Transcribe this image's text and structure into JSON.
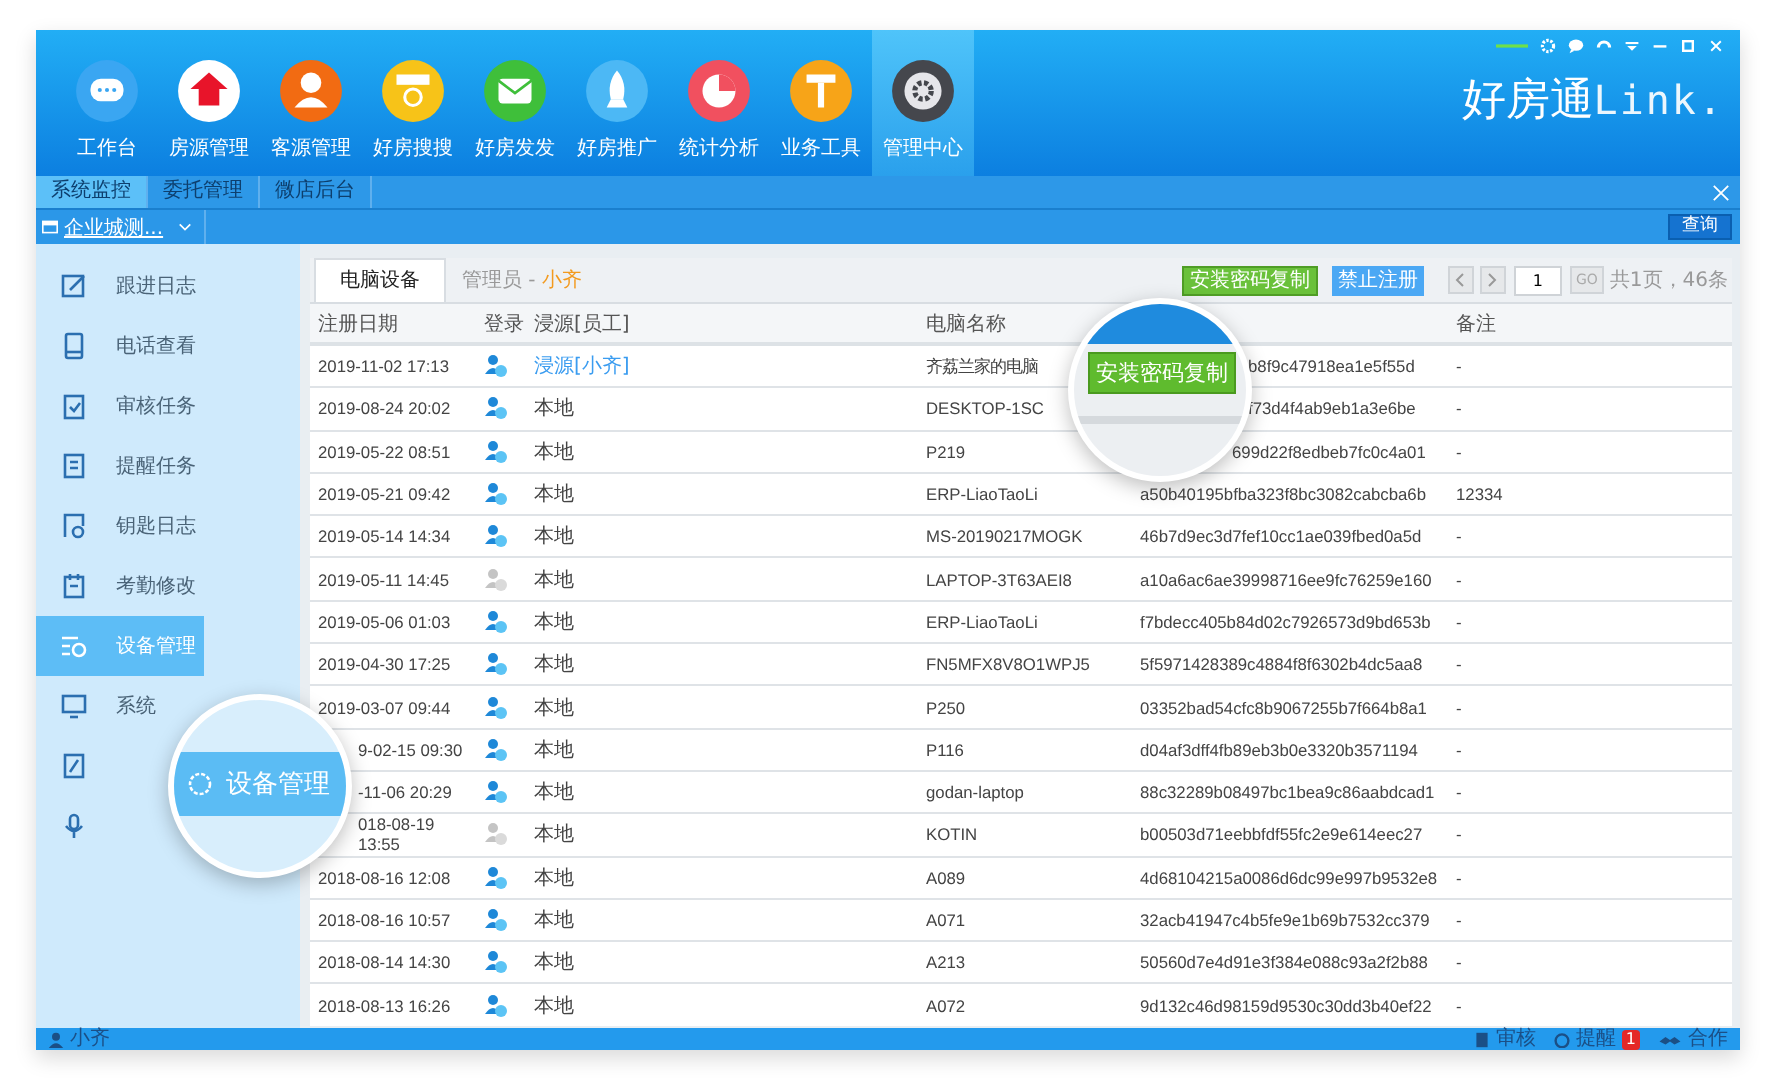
{
  "nav": [
    {
      "label": "工作台",
      "kind": "chat",
      "color": "#3aa6f2",
      "selected": false
    },
    {
      "label": "房源管理",
      "kind": "house",
      "color": "#ffffff",
      "selected": false
    },
    {
      "label": "客源管理",
      "kind": "person",
      "color": "#f26b12",
      "selected": false
    },
    {
      "label": "好房搜搜",
      "kind": "search",
      "color": "#f7c318",
      "selected": false
    },
    {
      "label": "好房发发",
      "kind": "mail",
      "color": "#3fbf3a",
      "selected": false
    },
    {
      "label": "好房推广",
      "kind": "rocket",
      "color": "#4cb8f5",
      "selected": false
    },
    {
      "label": "统计分析",
      "kind": "pie",
      "color": "#f1505f",
      "selected": false
    },
    {
      "label": "业务工具",
      "kind": "hammer",
      "color": "#f7a418",
      "selected": false
    },
    {
      "label": "管理中心",
      "kind": "gear",
      "color": "#45474d",
      "selected": true
    }
  ],
  "logo": {
    "brand": "好房通",
    "suffix": "Link."
  },
  "subtabs": [
    {
      "label": "系统监控",
      "selected": true
    },
    {
      "label": "委托管理",
      "selected": false
    },
    {
      "label": "微店后台",
      "selected": false
    }
  ],
  "filter": {
    "company": "企业城测...",
    "query_button": "查询"
  },
  "sidebar": [
    {
      "label": "跟进日志",
      "kind": "edit",
      "selected": false
    },
    {
      "label": "电话查看",
      "kind": "phone",
      "selected": false
    },
    {
      "label": "审核任务",
      "kind": "clipboard",
      "selected": false
    },
    {
      "label": "提醒任务",
      "kind": "doc",
      "selected": false
    },
    {
      "label": "钥匙日志",
      "kind": "key",
      "selected": false
    },
    {
      "label": "考勤修改",
      "kind": "calendar",
      "selected": false
    },
    {
      "label": "设备管理",
      "kind": "settings",
      "selected": true
    },
    {
      "label": "系统",
      "kind": "monitor",
      "selected": false
    },
    {
      "kind": "docedit",
      "selected": false
    },
    {
      "kind": "mic",
      "selected": false
    }
  ],
  "content_tab": {
    "label": "电脑设备",
    "admin_label": "管理员 -",
    "admin_name": "小齐"
  },
  "actions": {
    "copy_button": "安装密码复制",
    "block_button": "禁止注册",
    "page_input": "1",
    "go_button": "GO",
    "page_info": "共1页，46条"
  },
  "table": {
    "columns": [
      "注册日期",
      "登录",
      "浸源[员工]",
      "电脑名称",
      "备注"
    ],
    "rows": [
      {
        "date": "2019-11-02 17:13",
        "online": true,
        "source": "浸源[小齐]",
        "source_link": true,
        "name": "齐荔兰家的电脑",
        "code": "b8f9c47918ea1e5f55d",
        "note": "-"
      },
      {
        "date": "2019-08-24 20:02",
        "online": true,
        "source": "本地",
        "source_link": false,
        "name": "DESKTOP-1SC",
        "code": "f73d4f4ab9eb1a3e6be",
        "note": "-"
      },
      {
        "date": "2019-05-22 08:51",
        "online": true,
        "source": "本地",
        "source_link": false,
        "name": "P219",
        "code": "699d22f8edbeb7fc0c4a01",
        "note": "-"
      },
      {
        "date": "2019-05-21 09:42",
        "online": true,
        "source": "本地",
        "source_link": false,
        "name": "ERP-LiaoTaoLi",
        "code": "a50b40195bfba323f8bc3082cabcba6b",
        "note": "12334"
      },
      {
        "date": "2019-05-14 14:34",
        "online": true,
        "source": "本地",
        "source_link": false,
        "name": "MS-20190217MOGK",
        "code": "46b7d9ec3d7fef10cc1ae039fbed0a5d",
        "note": "-"
      },
      {
        "date": "2019-05-11 14:45",
        "online": false,
        "source": "本地",
        "source_link": false,
        "name": "LAPTOP-3T63AEI8",
        "code": "a10a6ac6ae39998716ee9fc76259e160",
        "note": "-"
      },
      {
        "date": "2019-05-06 01:03",
        "online": true,
        "source": "本地",
        "source_link": false,
        "name": "ERP-LiaoTaoLi",
        "code": "f7bdecc405b84d02c7926573d9bd653b",
        "note": "-"
      },
      {
        "date": "2019-04-30 17:25",
        "online": true,
        "source": "本地",
        "source_link": false,
        "name": "FN5MFX8V8O1WPJ5",
        "code": "5f5971428389c4884f8f6302b4dc5aa8",
        "note": "-"
      },
      {
        "date": "2019-03-07 09:44",
        "online": true,
        "source": "本地",
        "source_link": false,
        "name": "P250",
        "code": "03352bad54cfc8b9067255b7f664b8a1",
        "note": "-"
      },
      {
        "date": "9-02-15 09:30",
        "online": true,
        "source": "本地",
        "source_link": false,
        "name": "P116",
        "code": "d04af3dff4fb89eb3b0e3320b3571194",
        "note": "-"
      },
      {
        "date": "-11-06 20:29",
        "online": true,
        "source": "本地",
        "source_link": false,
        "name": "godan-laptop",
        "code": "88c32289b08497bc1bea9c86aabdcad1",
        "note": "-"
      },
      {
        "date": "018-08-19 13:55",
        "online": false,
        "source": "本地",
        "source_link": false,
        "name": "KOTIN",
        "code": "b00503d71eebbfdf55fc2e9e614eec27",
        "note": "-"
      },
      {
        "date": "2018-08-16 12:08",
        "online": true,
        "source": "本地",
        "source_link": false,
        "name": "A089",
        "code": "4d68104215a0086d6dc99e997b9532e8",
        "note": "-"
      },
      {
        "date": "2018-08-16 10:57",
        "online": true,
        "source": "本地",
        "source_link": false,
        "name": "A071",
        "code": "32acb41947c4b5fe9e1b69b7532cc379",
        "note": "-"
      },
      {
        "date": "2018-08-14 14:30",
        "online": true,
        "source": "本地",
        "source_link": false,
        "name": "A213",
        "code": "50560d7e4d91e3f384e088c93a2f2b88",
        "note": "-"
      },
      {
        "date": "2018-08-13 16:26",
        "online": true,
        "source": "本地",
        "source_link": false,
        "name": "A072",
        "code": "9d132c46d98159d9530c30dd3b40ef22",
        "note": "-"
      }
    ]
  },
  "magnifiers": {
    "button_label": "安装密码复制",
    "menu_label": "设备管理"
  },
  "status_bar": {
    "user": "小齐",
    "review": "审核",
    "remind": "提醒",
    "remind_badge": "1",
    "cooperate": "合作"
  }
}
